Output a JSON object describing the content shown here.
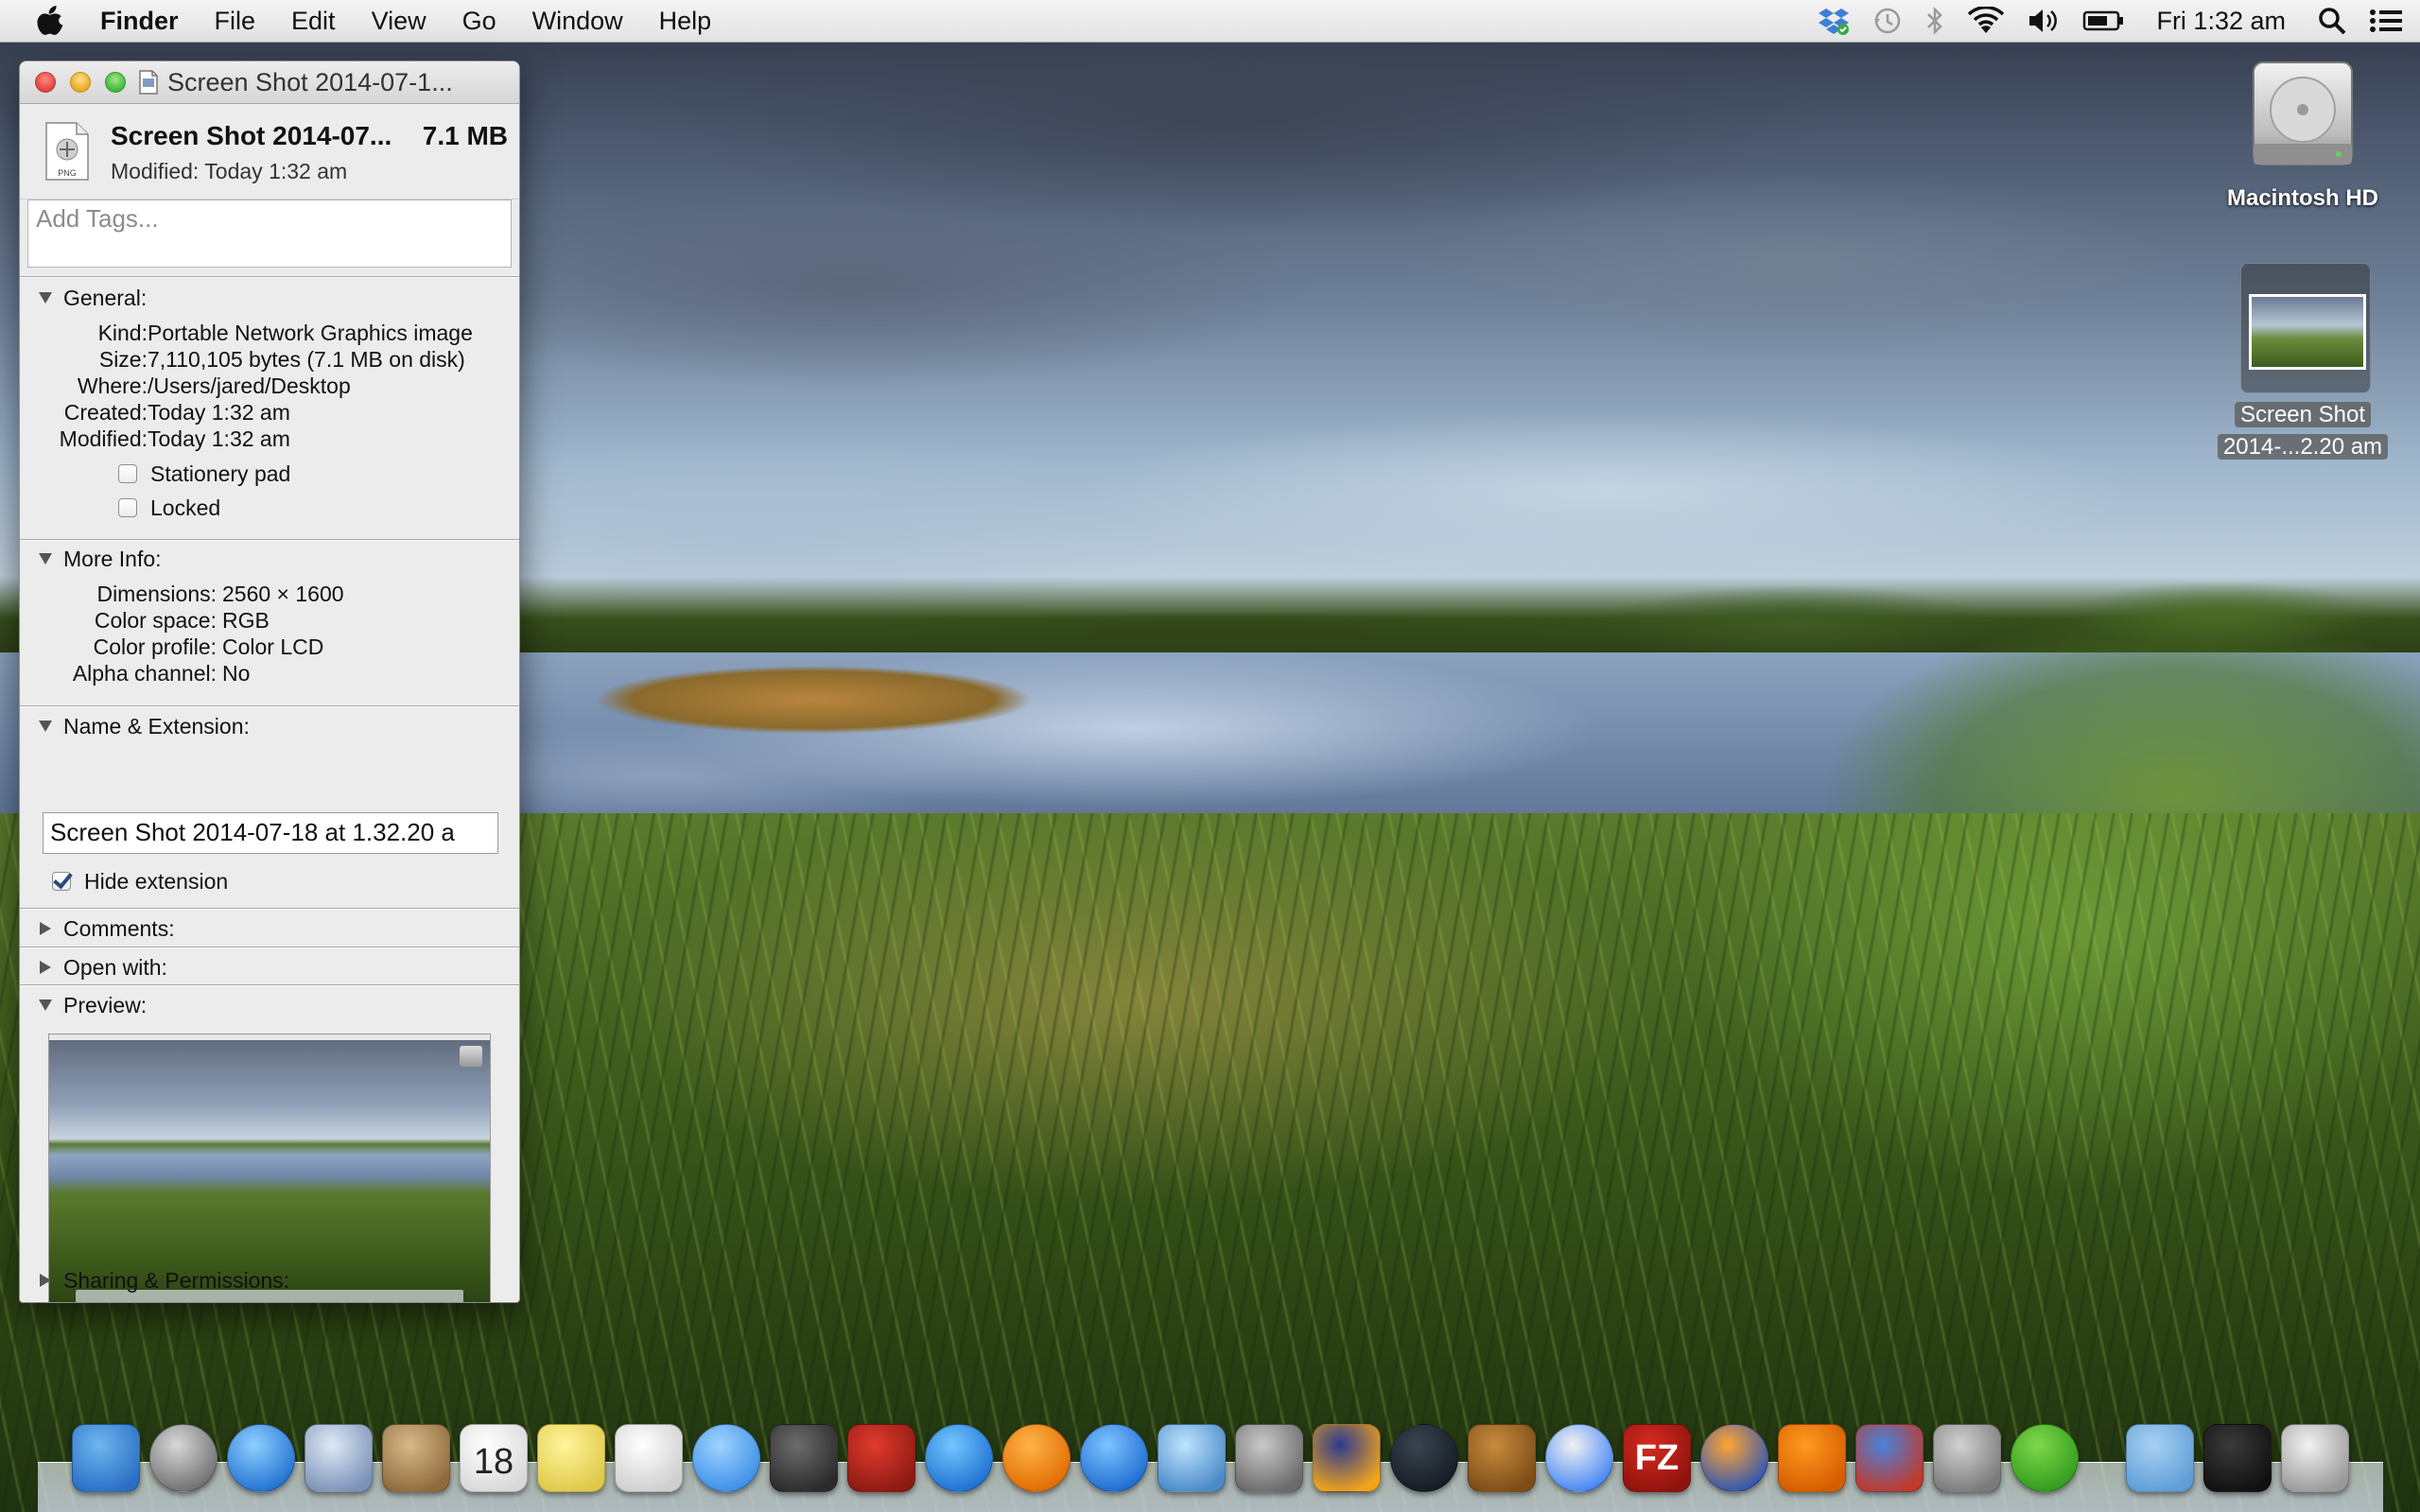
{
  "menubar": {
    "app_name": "Finder",
    "menus": [
      "File",
      "Edit",
      "View",
      "Go",
      "Window",
      "Help"
    ],
    "clock": "Fri 1:32 am"
  },
  "window": {
    "title": "Screen Shot 2014-07-1...",
    "file_name": "Screen Shot 2014-07...",
    "file_size": "7.1 MB",
    "modified_summary": "Modified: Today 1:32 am",
    "icon_badge": "PNG",
    "tags_placeholder": "Add Tags...",
    "general": {
      "header": "General:",
      "rows": [
        {
          "label": "Kind:",
          "value": "Portable Network Graphics image"
        },
        {
          "label": "Size:",
          "value": "7,110,105 bytes (7.1 MB on disk)"
        },
        {
          "label": "Where:",
          "value": "/Users/jared/Desktop"
        },
        {
          "label": "Created:",
          "value": "Today 1:32 am"
        },
        {
          "label": "Modified:",
          "value": "Today 1:32 am"
        }
      ],
      "stationery_label": "Stationery pad",
      "locked_label": "Locked"
    },
    "more_info": {
      "header": "More Info:",
      "rows": [
        {
          "label": "Dimensions:",
          "value": "2560 × 1600"
        },
        {
          "label": "Color space:",
          "value": "RGB"
        },
        {
          "label": "Color profile:",
          "value": "Color LCD"
        },
        {
          "label": "Alpha channel:",
          "value": "No"
        }
      ]
    },
    "name_extension": {
      "header": "Name & Extension:",
      "value": "Screen Shot 2014-07-18 at 1.32.20 a",
      "hide_extension_label": "Hide extension",
      "hide_extension_checked": true
    },
    "comments_header": "Comments:",
    "open_with_header": "Open with:",
    "preview_header": "Preview:",
    "sharing_header": "Sharing & Permissions:"
  },
  "desktop_icons": {
    "hd_label": "Macintosh HD",
    "screenshot_label_line1": "Screen Shot",
    "screenshot_label_line2": "2014-...2.20 am"
  },
  "dock": {
    "icons": [
      "finder-icon",
      "launchpad-icon",
      "safari-icon",
      "mail-icon",
      "contacts-icon",
      "calendar-icon",
      "notes-icon",
      "reminders-icon",
      "messages-icon",
      "facetime-icon",
      "photo-booth-icon",
      "itunes-icon",
      "ibooks-icon",
      "app-store-icon",
      "iphoto-icon",
      "system-preferences-icon",
      "audacity-icon",
      "istat-icon",
      "archive-utility-icon",
      "chrome-icon",
      "filezilla-icon",
      "firefox-icon",
      "vlc-icon",
      "teamviewer-icon",
      "xcode-tools-icon",
      "utorrent-icon",
      "folder-icon",
      "music-folder-icon",
      "trash-icon"
    ],
    "calendar_day": "18"
  }
}
